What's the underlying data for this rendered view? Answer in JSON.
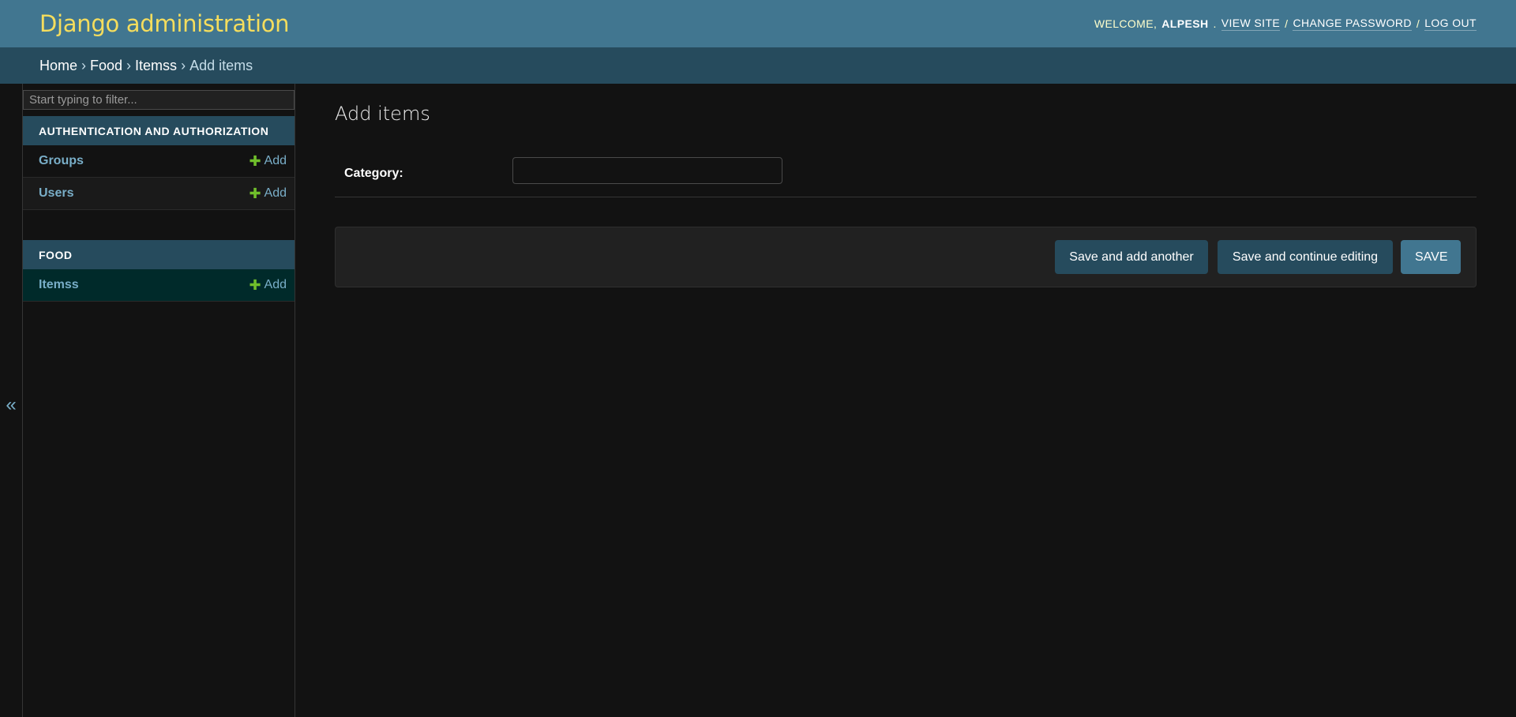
{
  "header": {
    "brand": "Django administration",
    "welcome": "WELCOME,",
    "username": "ALPESH",
    "view_site": "VIEW SITE",
    "change_password": "CHANGE PASSWORD",
    "log_out": "LOG OUT",
    "separator": "/"
  },
  "breadcrumbs": {
    "items": [
      "Home",
      "Food",
      "Itemss"
    ],
    "current": "Add items",
    "separator": "›"
  },
  "sidebar": {
    "toggle": "«",
    "filter_placeholder": "Start typing to filter...",
    "apps": [
      {
        "caption": "AUTHENTICATION AND AUTHORIZATION",
        "models": [
          {
            "name": "Groups",
            "add": "Add"
          },
          {
            "name": "Users",
            "add": "Add"
          }
        ]
      },
      {
        "caption": "FOOD",
        "models": [
          {
            "name": "Itemss",
            "add": "Add"
          }
        ]
      }
    ],
    "add_icon": "plus-icon"
  },
  "content": {
    "title": "Add items",
    "form": {
      "category_label": "Category:",
      "category_value": ""
    },
    "buttons": {
      "save_add_another": "Save and add another",
      "save_continue": "Save and continue editing",
      "save": "SAVE"
    }
  },
  "colors": {
    "header_bg": "#417690",
    "breadcrumbs_bg": "#264b5d",
    "brand": "#f5dd5d",
    "link": "#79aec8",
    "add_plus": "#70bf2b",
    "page_bg": "#121212"
  }
}
